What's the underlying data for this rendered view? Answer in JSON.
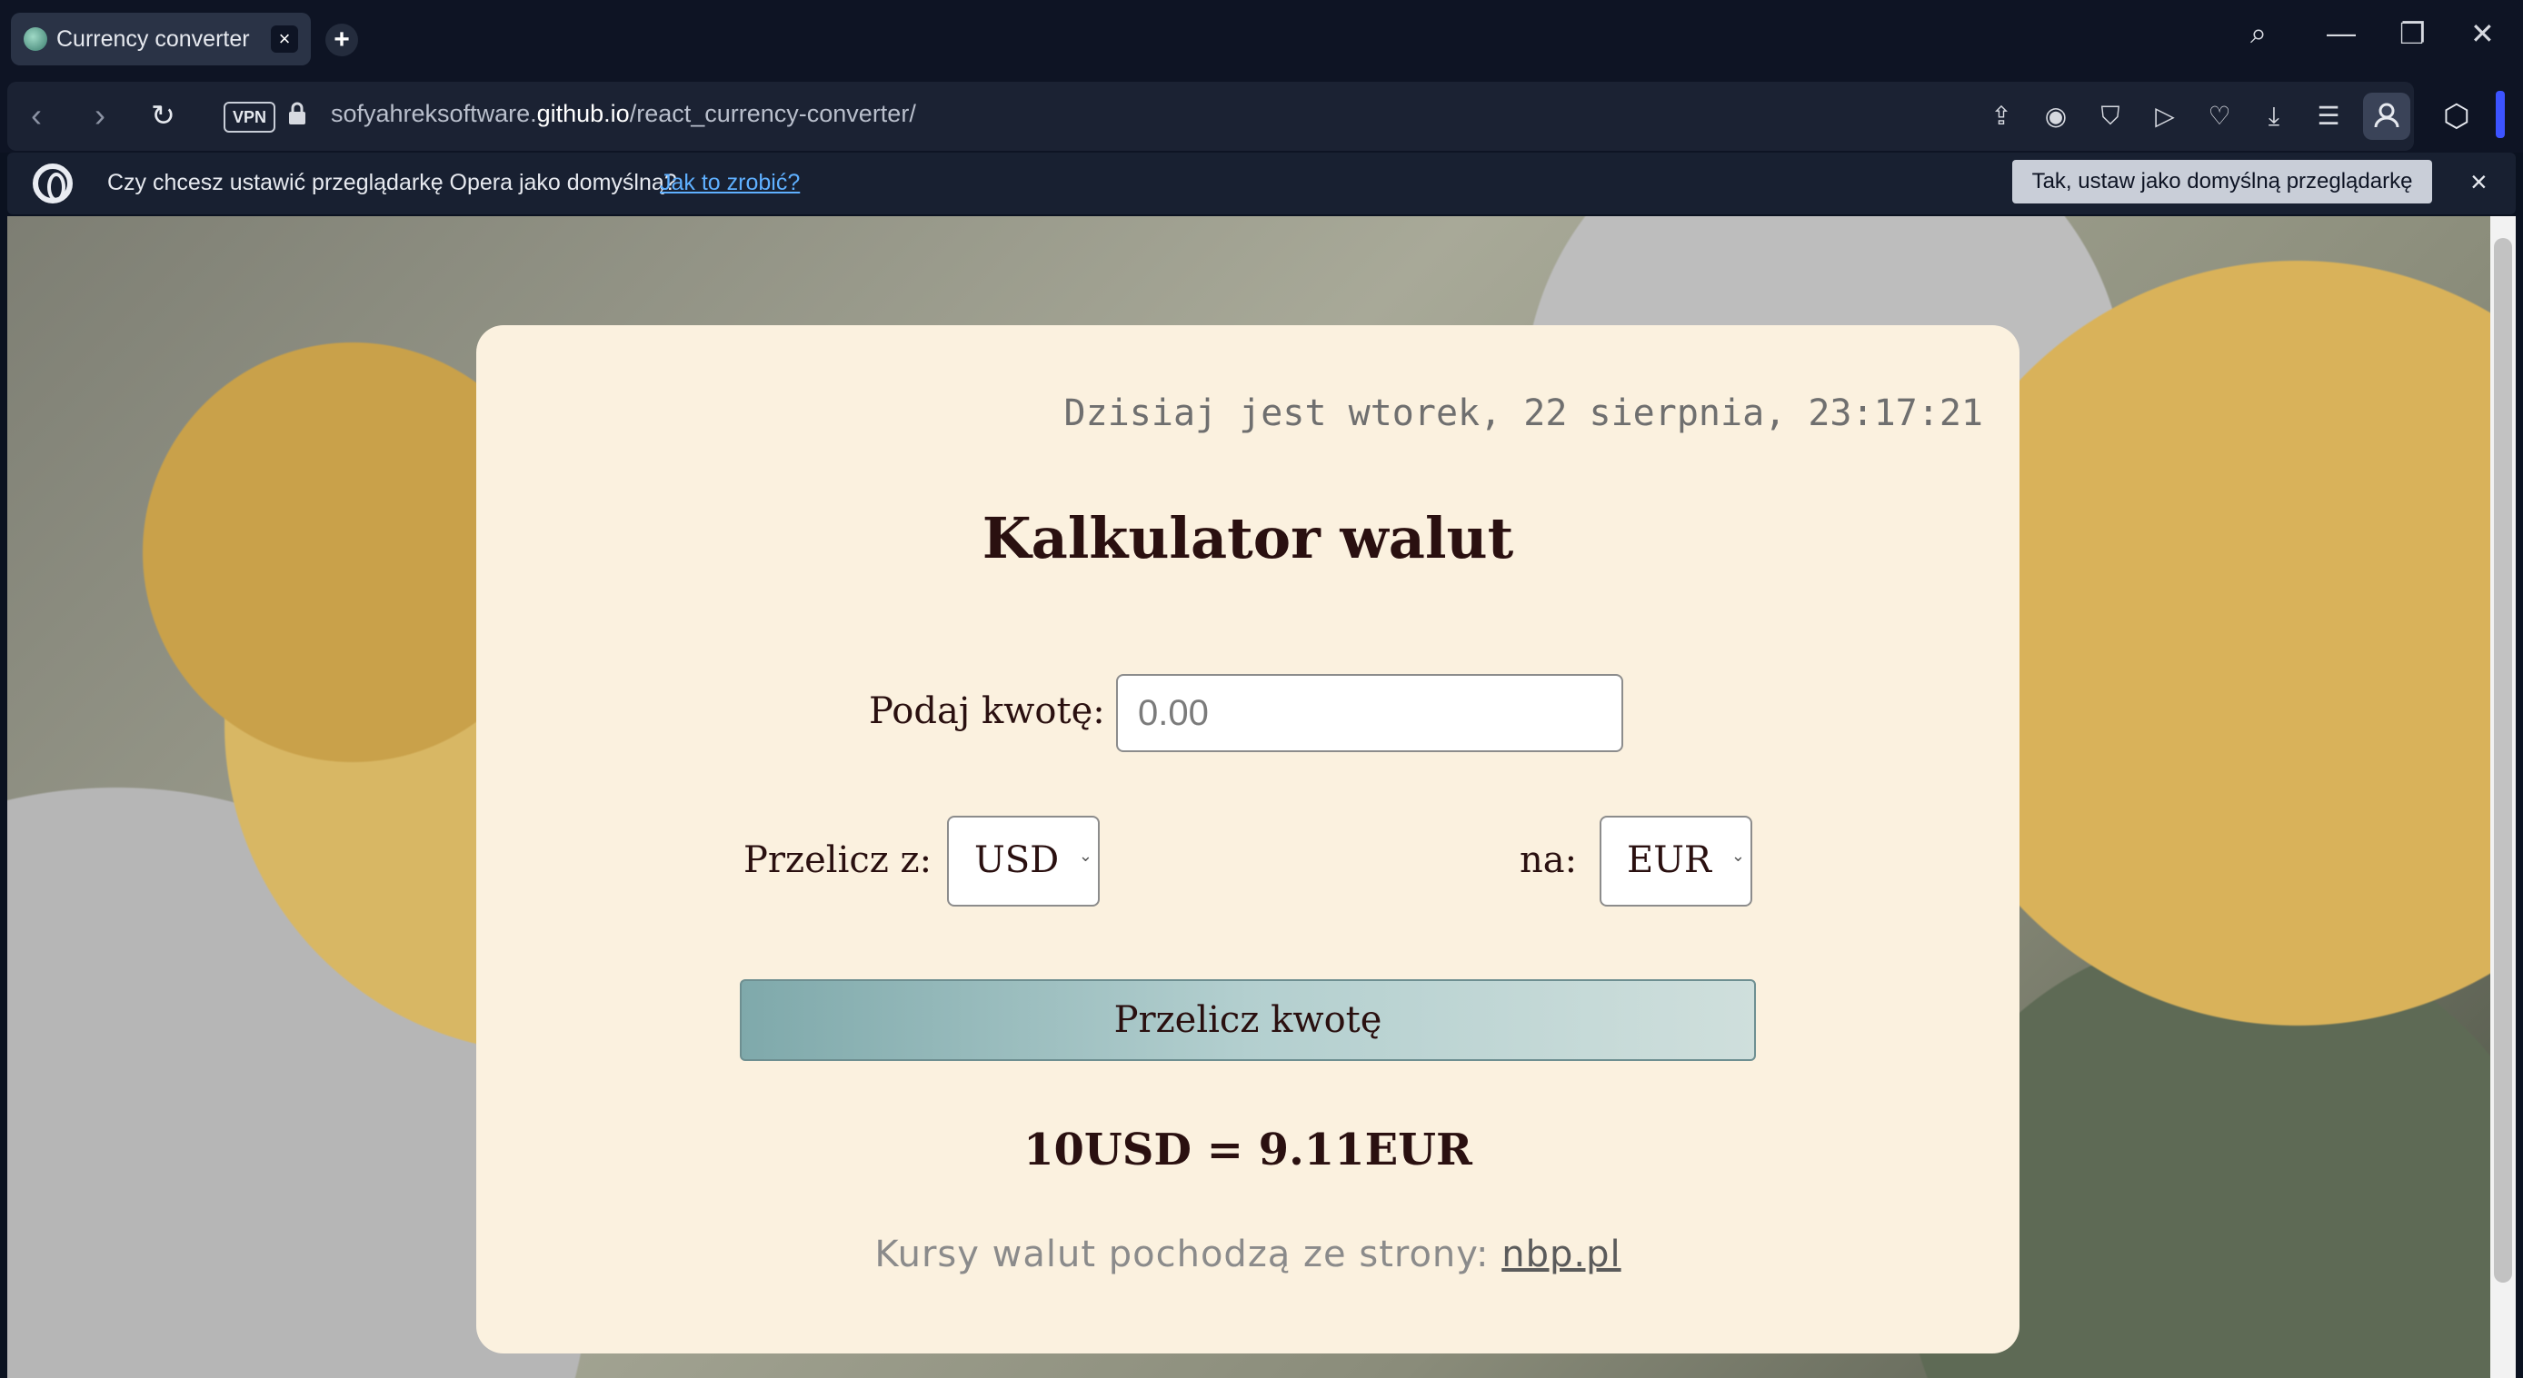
{
  "browser": {
    "tab": {
      "title": "Currency converter",
      "close": "×"
    },
    "new_tab": "+",
    "window_controls": {
      "search": "⌕",
      "minimize": "—",
      "restore": "❐",
      "close": "✕"
    },
    "nav": {
      "back": "‹",
      "forward": "›",
      "reload": "↻"
    },
    "vpn_label": "VPN",
    "url": {
      "prefix": "sofyahreksoftware.",
      "domain": "github.io",
      "path": "/react_currency-converter/"
    },
    "toolbar_icons": [
      "share-icon",
      "camera-icon",
      "shield-icon",
      "play-icon",
      "heart-icon",
      "download-icon",
      "settings-icon",
      "profile-icon"
    ],
    "infobar": {
      "text": "Czy chcesz ustawić przeglądarkę Opera jako domyślną?",
      "link": "Jak to zrobić?",
      "button": "Tak, ustaw jako domyślną przeglądarkę",
      "close": "×"
    }
  },
  "app": {
    "datetime": "Dzisiaj jest wtorek, 22 sierpnia, 23:17:21",
    "title": "Kalkulator walut",
    "amount_label": "Podaj kwotę:",
    "amount_placeholder": "0.00",
    "from_label": "Przelicz z:",
    "from_value": "USD",
    "to_label": "na:",
    "to_value": "EUR",
    "convert_button": "Przelicz kwotę",
    "result": "10USD = 9.11EUR",
    "source_text": "Kursy walut pochodzą ze strony:",
    "source_link": "nbp.pl"
  }
}
